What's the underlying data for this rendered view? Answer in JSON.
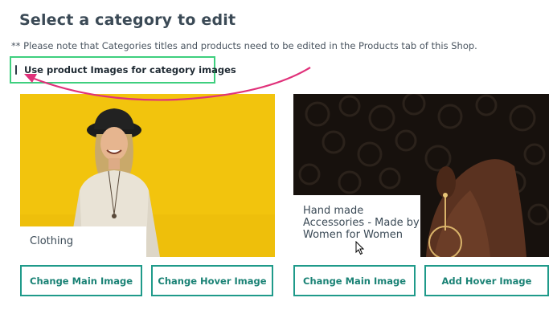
{
  "page": {
    "title": "Select a category to edit",
    "note": "** Please note that Categories titles and products need to be edited in the Products tab of this Shop."
  },
  "option": {
    "label": "Use product Images for category images",
    "checked": false
  },
  "categories": [
    {
      "label": "Clothing",
      "buttons": {
        "main": "Change Main Image",
        "hover": "Change Hover Image"
      }
    },
    {
      "label": "Hand made Accessories - Made by Women for Women",
      "buttons": {
        "main": "Change Main Image",
        "hover": "Add Hover Image"
      }
    }
  ],
  "colors": {
    "accent": "#1f9a8a",
    "highlight_border": "#3ecf7e",
    "annotation_arrow": "#e0317a"
  },
  "icons": [
    "checkbox-icon",
    "annotation-arrow-icon",
    "mouse-cursor-icon"
  ]
}
